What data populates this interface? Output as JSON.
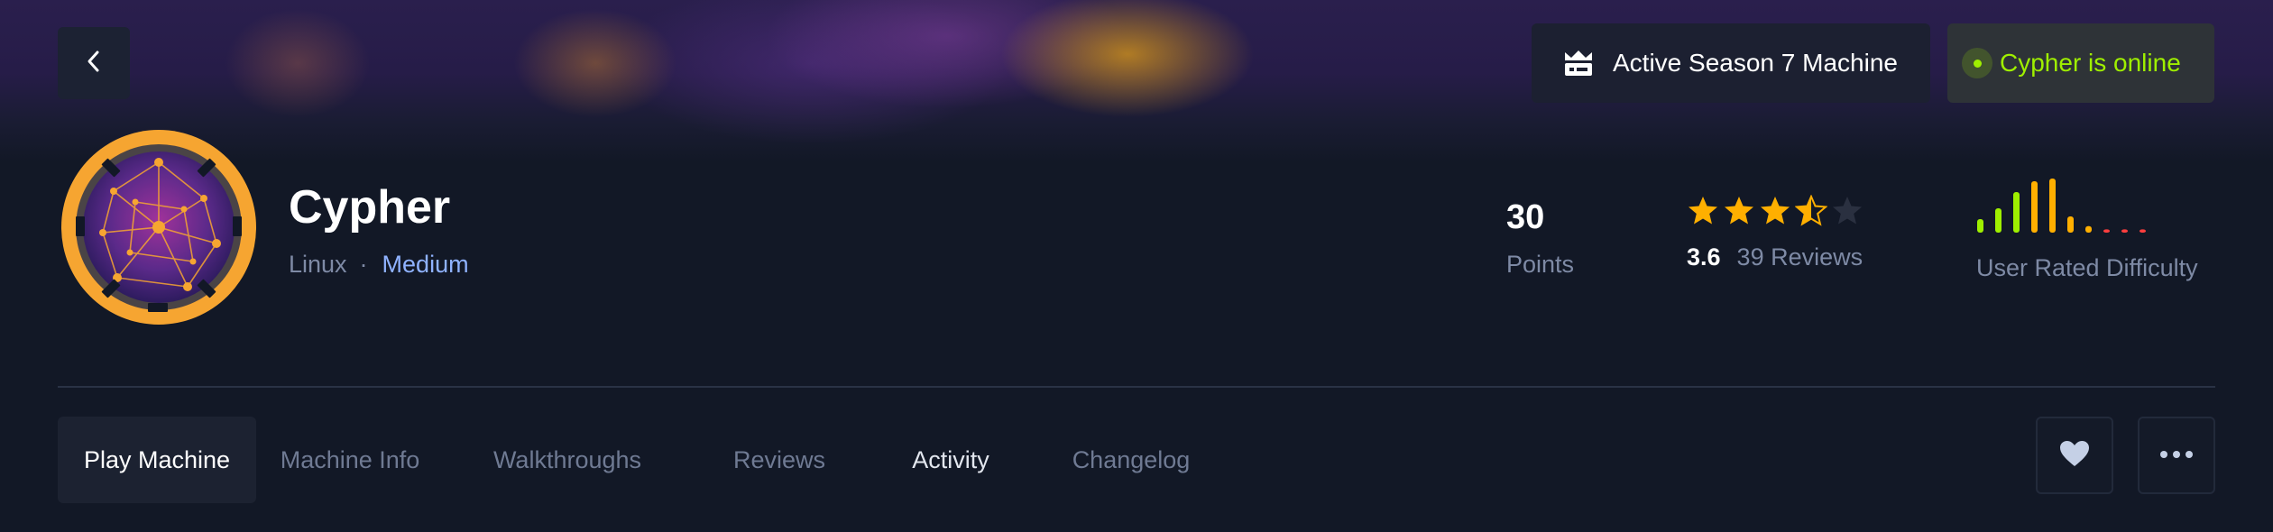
{
  "header": {
    "back_label": "Back",
    "season_badge": "Active Season 7 Machine",
    "status_badge": "Cypher is online"
  },
  "machine": {
    "name": "Cypher",
    "os": "Linux",
    "separator": "·",
    "difficulty": "Medium"
  },
  "stats": {
    "points_value": "30",
    "points_label": "Points",
    "rating_value": "3.6",
    "rating_stars": 3.5,
    "rating_max": 5,
    "reviews_label": "39 Reviews",
    "difficulty_label": "User Rated Difficulty",
    "difficulty_bar_levels": [
      0.25,
      0.45,
      0.75,
      0.95,
      1.0,
      0.3,
      0.12,
      0.06,
      0.06,
      0.06
    ],
    "difficulty_bar_colors": [
      "#9fef00",
      "#9fef00",
      "#9fef00",
      "#ffaf00",
      "#ffaf00",
      "#ffaf00",
      "#ffaf00",
      "#ff3e3e",
      "#ff3e3e",
      "#ff3e3e"
    ]
  },
  "tabs": [
    {
      "label": "Play Machine",
      "state": "active"
    },
    {
      "label": "Machine Info",
      "state": "muted"
    },
    {
      "label": "Walkthroughs",
      "state": "muted"
    },
    {
      "label": "Reviews",
      "state": "muted"
    },
    {
      "label": "Activity",
      "state": "bright"
    },
    {
      "label": "Changelog",
      "state": "muted"
    }
  ],
  "actions": {
    "favorite_icon": "heart-icon",
    "more_icon": "more-options-icon"
  },
  "colors": {
    "accent_green": "#9fef00",
    "accent_orange": "#ffaf00",
    "star_empty": "#2a3040",
    "link_blue": "#8fb2ff"
  }
}
